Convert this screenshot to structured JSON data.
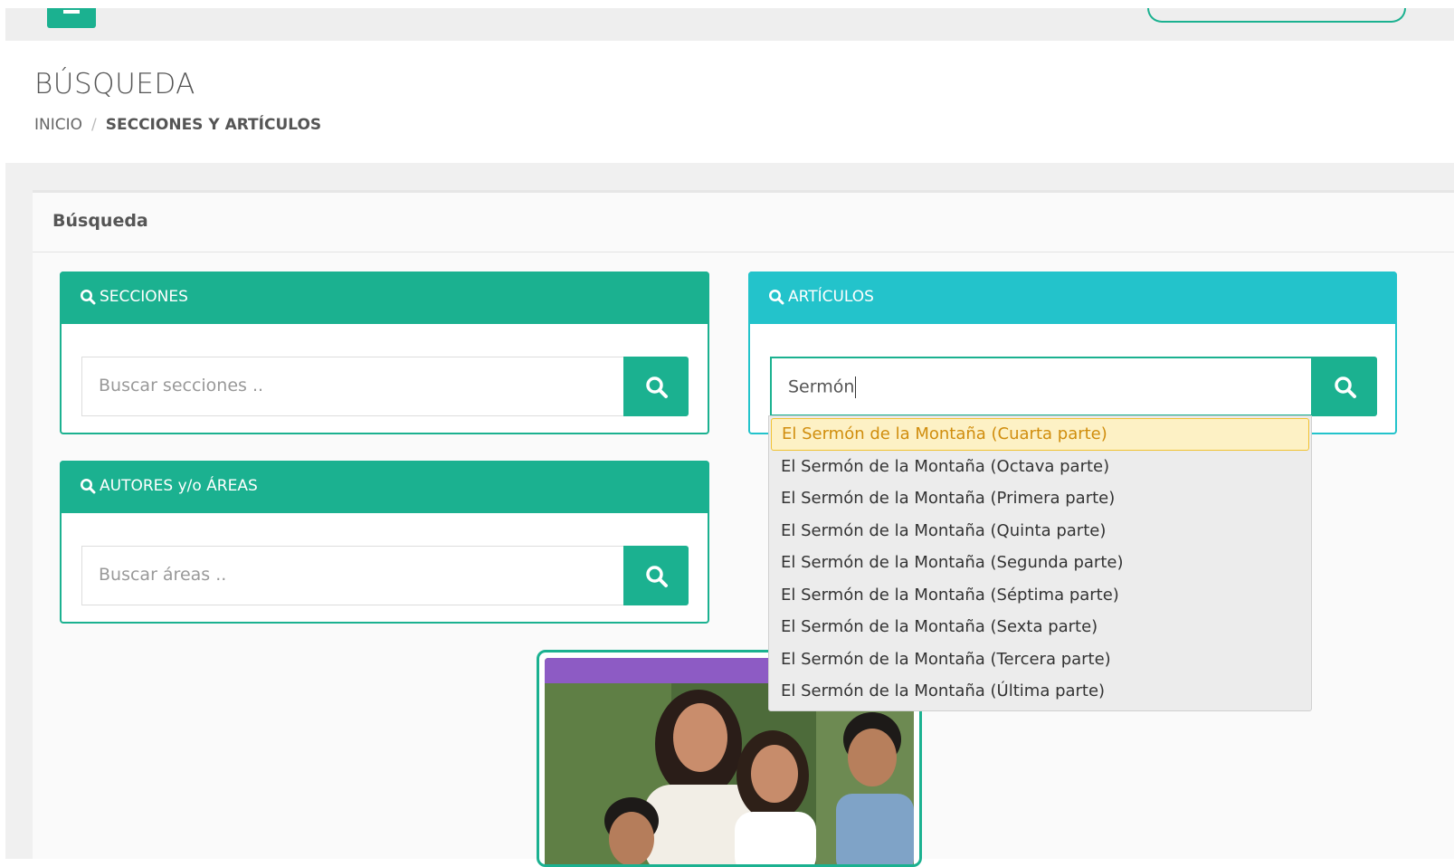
{
  "page": {
    "title": "BÚSQUEDA",
    "breadcrumb": {
      "home": "INICIO",
      "separator": "/",
      "current": "SECCIONES Y ARTÍCULOS"
    }
  },
  "card": {
    "title": "Búsqueda"
  },
  "panels": {
    "secciones": {
      "title": "SECCIONES",
      "placeholder": "Buscar secciones ..",
      "icon": "search-icon"
    },
    "articulos": {
      "title": "ARTÍCULOS",
      "value": "Sermón",
      "icon": "search-icon"
    },
    "autores": {
      "title": "AUTORES y/o ÁREAS",
      "placeholder": "Buscar áreas ..",
      "icon": "search-icon"
    }
  },
  "suggestions": [
    "El Sermón de la Montaña (Cuarta parte)",
    "El Sermón de la Montaña (Octava parte)",
    "El Sermón de la Montaña (Primera parte)",
    "El Sermón de la Montaña (Quinta parte)",
    "El Sermón de la Montaña (Segunda parte)",
    "El Sermón de la Montaña (Séptima parte)",
    "El Sermón de la Montaña (Sexta parte)",
    "El Sermón de la Montaña (Tercera parte)",
    "El Sermón de la Montaña (Última parte)"
  ],
  "colors": {
    "green": "#1bb190",
    "cyan": "#23c3cb",
    "highlight_bg": "#fdf1c5",
    "highlight_text": "#d08d0d"
  }
}
